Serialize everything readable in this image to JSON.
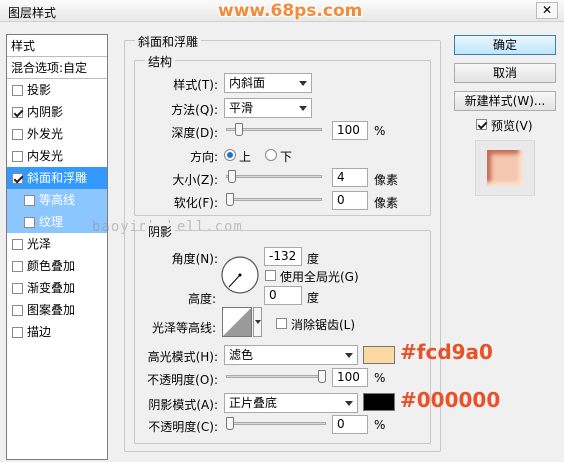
{
  "window": {
    "title": "图层样式",
    "watermark": "www.68ps.com",
    "close_glyph": "✕"
  },
  "style_list": {
    "header": "样式",
    "blend_options": "混合选项:自定",
    "items": [
      {
        "label": "投影",
        "checked": false
      },
      {
        "label": "内阴影",
        "checked": true
      },
      {
        "label": "外发光",
        "checked": false
      },
      {
        "label": "内发光",
        "checked": false
      },
      {
        "label": "斜面和浮雕",
        "checked": true,
        "selected": true
      },
      {
        "label": "等高线",
        "checked": false,
        "sub": true
      },
      {
        "label": "纹理",
        "checked": false,
        "sub": true
      },
      {
        "label": "光泽",
        "checked": false
      },
      {
        "label": "颜色叠加",
        "checked": false
      },
      {
        "label": "渐变叠加",
        "checked": false
      },
      {
        "label": "图案叠加",
        "checked": false
      },
      {
        "label": "描边",
        "checked": false
      }
    ],
    "overlay_watermark": "baoyinb    bell.com"
  },
  "bevel": {
    "group_title": "斜面和浮雕",
    "structure": {
      "title": "结构",
      "style_label": "样式(T):",
      "style_value": "内斜面",
      "technique_label": "方法(Q):",
      "technique_value": "平滑",
      "depth_label": "深度(D):",
      "depth_value": "100",
      "depth_fraction": 0.1,
      "depth_unit": "%",
      "direction_label": "方向:",
      "direction_up": "上",
      "direction_down": "下",
      "size_label": "大小(Z):",
      "size_value": "4",
      "size_unit": "像素",
      "size_fraction": 0.02,
      "soften_label": "软化(F):",
      "soften_value": "0",
      "soften_unit": "像素",
      "soften_fraction": 0.0
    },
    "shading": {
      "title": "阴影",
      "angle_label": "角度(N):",
      "angle_value": "-132",
      "angle_unit": "度",
      "global_light_label": "使用全局光(G)",
      "altitude_label": "高度:",
      "altitude_value": "0",
      "altitude_unit": "度",
      "gloss_contour_label": "光泽等高线:",
      "anti_alias_label": "消除锯齿(L)",
      "highlight_mode_label": "高光模式(H):",
      "highlight_mode_value": "滤色",
      "highlight_color": "#fcd9a0",
      "highlight_opacity_label": "不透明度(O):",
      "highlight_opacity_value": "100",
      "highlight_opacity_fraction": 1.0,
      "shadow_mode_label": "阴影模式(A):",
      "shadow_mode_value": "正片叠底",
      "shadow_color": "#000000",
      "shadow_opacity_label": "不透明度(C):",
      "shadow_opacity_value": "0",
      "shadow_opacity_fraction": 0.0,
      "percent_unit": "%"
    }
  },
  "annotations": {
    "highlight_hex": "#fcd9a0",
    "shadow_hex": "#000000"
  },
  "buttons": {
    "ok": "确定",
    "cancel": "取消",
    "new_style": "新建样式(W)...",
    "preview_label": "预览(V)",
    "preview_checked": true
  }
}
